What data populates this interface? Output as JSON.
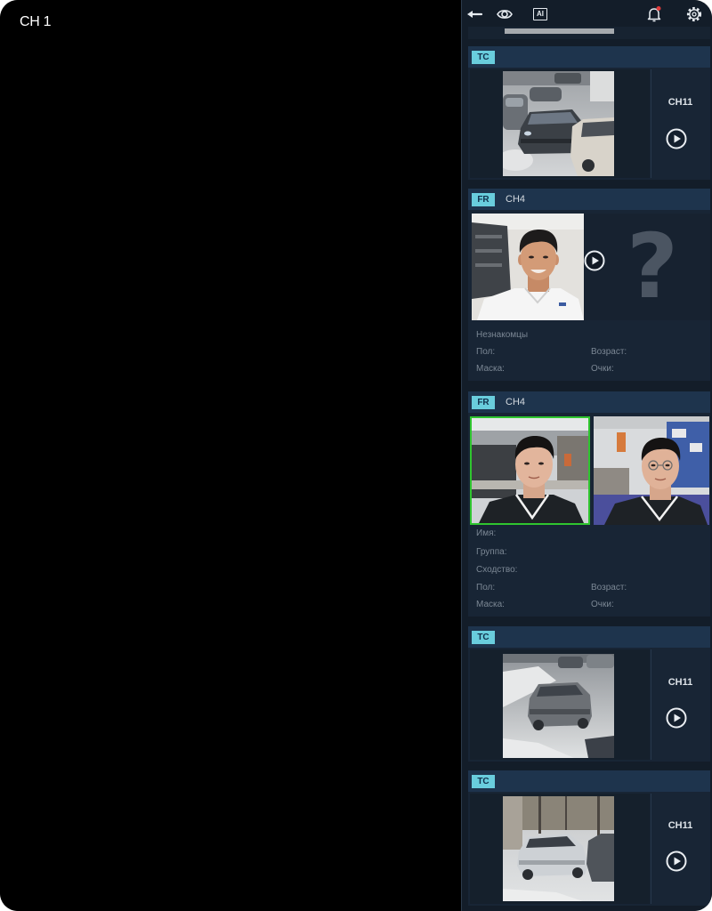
{
  "main_view": {
    "channel_label": "CH 1"
  },
  "toolbar": {
    "icons": [
      "back-arrow-icon",
      "eye-icon",
      "ai-icon",
      "bell-icon",
      "gear-icon"
    ],
    "ai_label": "AI",
    "bell_alert": true
  },
  "colors": {
    "main_bg": "#000000",
    "panel_bg": "#131d29",
    "card_bg": "#182535",
    "card_header_bg": "#1e344d",
    "badge_bg": "#69cddd",
    "badge_text": "#10304c",
    "match_border": "#2fc52f",
    "alert_dot": "#e23b3b"
  },
  "events": [
    {
      "badge": "TC",
      "channel": "CH11",
      "action_icon": "play-icon"
    },
    {
      "badge": "FR",
      "channel": "CH4",
      "status": "Незнакомцы",
      "unknown_symbol": "?",
      "action_icon": "play-icon",
      "fields": {
        "gender": "Пол:",
        "age": "Возраст:",
        "mask": "Маска:",
        "glasses": "Очки:"
      }
    },
    {
      "badge": "FR",
      "channel": "CH4",
      "fields": {
        "name": "Имя:",
        "group": "Группа:",
        "similarity": "Сходство:",
        "gender": "Пол:",
        "age": "Возраст:",
        "mask": "Маска:",
        "glasses": "Очки:"
      }
    },
    {
      "badge": "TC",
      "channel": "CH11",
      "action_icon": "play-icon"
    },
    {
      "badge": "TC",
      "channel": "CH11",
      "action_icon": "play-icon"
    }
  ]
}
